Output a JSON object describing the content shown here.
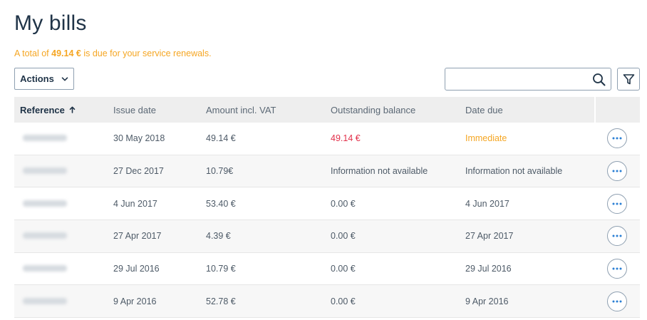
{
  "page": {
    "title": "My bills",
    "notice_prefix": "A total of ",
    "notice_amount": "49.14 €",
    "notice_suffix": " is due for your service renewals."
  },
  "toolbar": {
    "actions_label": "Actions",
    "search_value": "",
    "search_placeholder": ""
  },
  "colors": {
    "accent_orange": "#f5a623",
    "overdue_red": "#e2304a",
    "heading_navy": "#1f3347"
  },
  "table": {
    "columns": {
      "reference": "Reference",
      "issue_date": "Issue date",
      "amount": "Amount incl. VAT",
      "outstanding": "Outstanding balance",
      "due_date": "Date due"
    },
    "sort": {
      "column": "reference",
      "direction": "ascending"
    },
    "rows": [
      {
        "issue_date": "30 May 2018",
        "amount": "49.14 €",
        "outstanding": "49.14 €",
        "due_date": "Immediate"
      },
      {
        "issue_date": "27 Dec 2017",
        "amount": "10.79€",
        "outstanding": "Information not available",
        "due_date": "Information not available"
      },
      {
        "issue_date": "4 Jun 2017",
        "amount": "53.40 €",
        "outstanding": "0.00 €",
        "due_date": "4 Jun 2017"
      },
      {
        "issue_date": "27 Apr 2017",
        "amount": "4.39 €",
        "outstanding": "0.00 €",
        "due_date": "27 Apr 2017"
      },
      {
        "issue_date": "29 Jul 2016",
        "amount": "10.79 €",
        "outstanding": "0.00 €",
        "due_date": "29 Jul 2016"
      },
      {
        "issue_date": "9 Apr 2016",
        "amount": "52.78 €",
        "outstanding": "0.00 €",
        "due_date": "9 Apr 2016"
      }
    ]
  },
  "icons": {
    "actions_chevron": "chevron-down-icon",
    "sort": "arrow-up-icon",
    "search": "search-icon",
    "filter": "filter-icon",
    "row_more": "more-horizontal-icon"
  }
}
